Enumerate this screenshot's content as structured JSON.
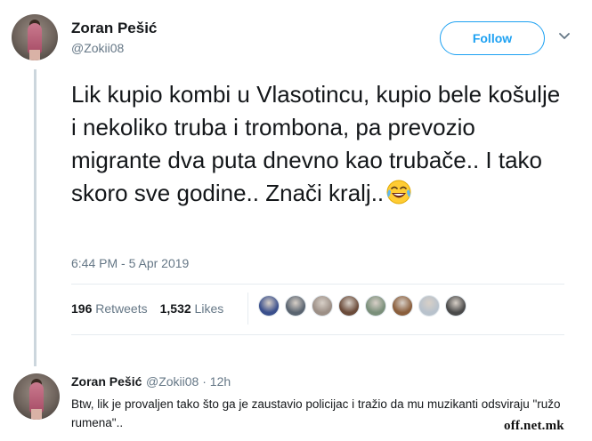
{
  "tweet": {
    "author_name": "Zoran Pešić",
    "author_handle": "@Zokii08",
    "follow_label": "Follow",
    "text": "Lik kupio kombi u Vlasotincu, kupio bele košulje i nekoliko truba i trombona, pa prevozio migrante dva puta dnevno kao trubače.. I tako skoro sve godine.. Znači kralj..",
    "emoji": "face-with-tears-of-joy-icon",
    "timestamp": "6:44 PM - 5 Apr 2019",
    "retweets_count": "196",
    "retweets_label": "Retweets",
    "likes_count": "1,532",
    "likes_label": "Likes"
  },
  "likers": [
    {
      "name": "liker-avatar-1",
      "color": "#3a4f8c"
    },
    {
      "name": "liker-avatar-2",
      "color": "#5a6470"
    },
    {
      "name": "liker-avatar-3",
      "color": "#9c8f86"
    },
    {
      "name": "liker-avatar-4",
      "color": "#6b4b3a"
    },
    {
      "name": "liker-avatar-5",
      "color": "#7a8f7a"
    },
    {
      "name": "liker-avatar-6",
      "color": "#8a5e3c"
    },
    {
      "name": "liker-avatar-7",
      "color": "#b8c2cc"
    },
    {
      "name": "liker-avatar-8",
      "color": "#4a4a4a"
    }
  ],
  "reply": {
    "author_name": "Zoran Pešić",
    "author_handle": "@Zokii08",
    "time": "12h",
    "text": "Btw, lik je provaljen tako što ga je zaustavio policijac i tražio da mu muzikanti odsviraju \"ružo rumena\".."
  },
  "watermark": "off.net.mk",
  "colors": {
    "accent": "#1da1f2",
    "secondary_text": "#657786",
    "divider": "#e6ecf0"
  }
}
